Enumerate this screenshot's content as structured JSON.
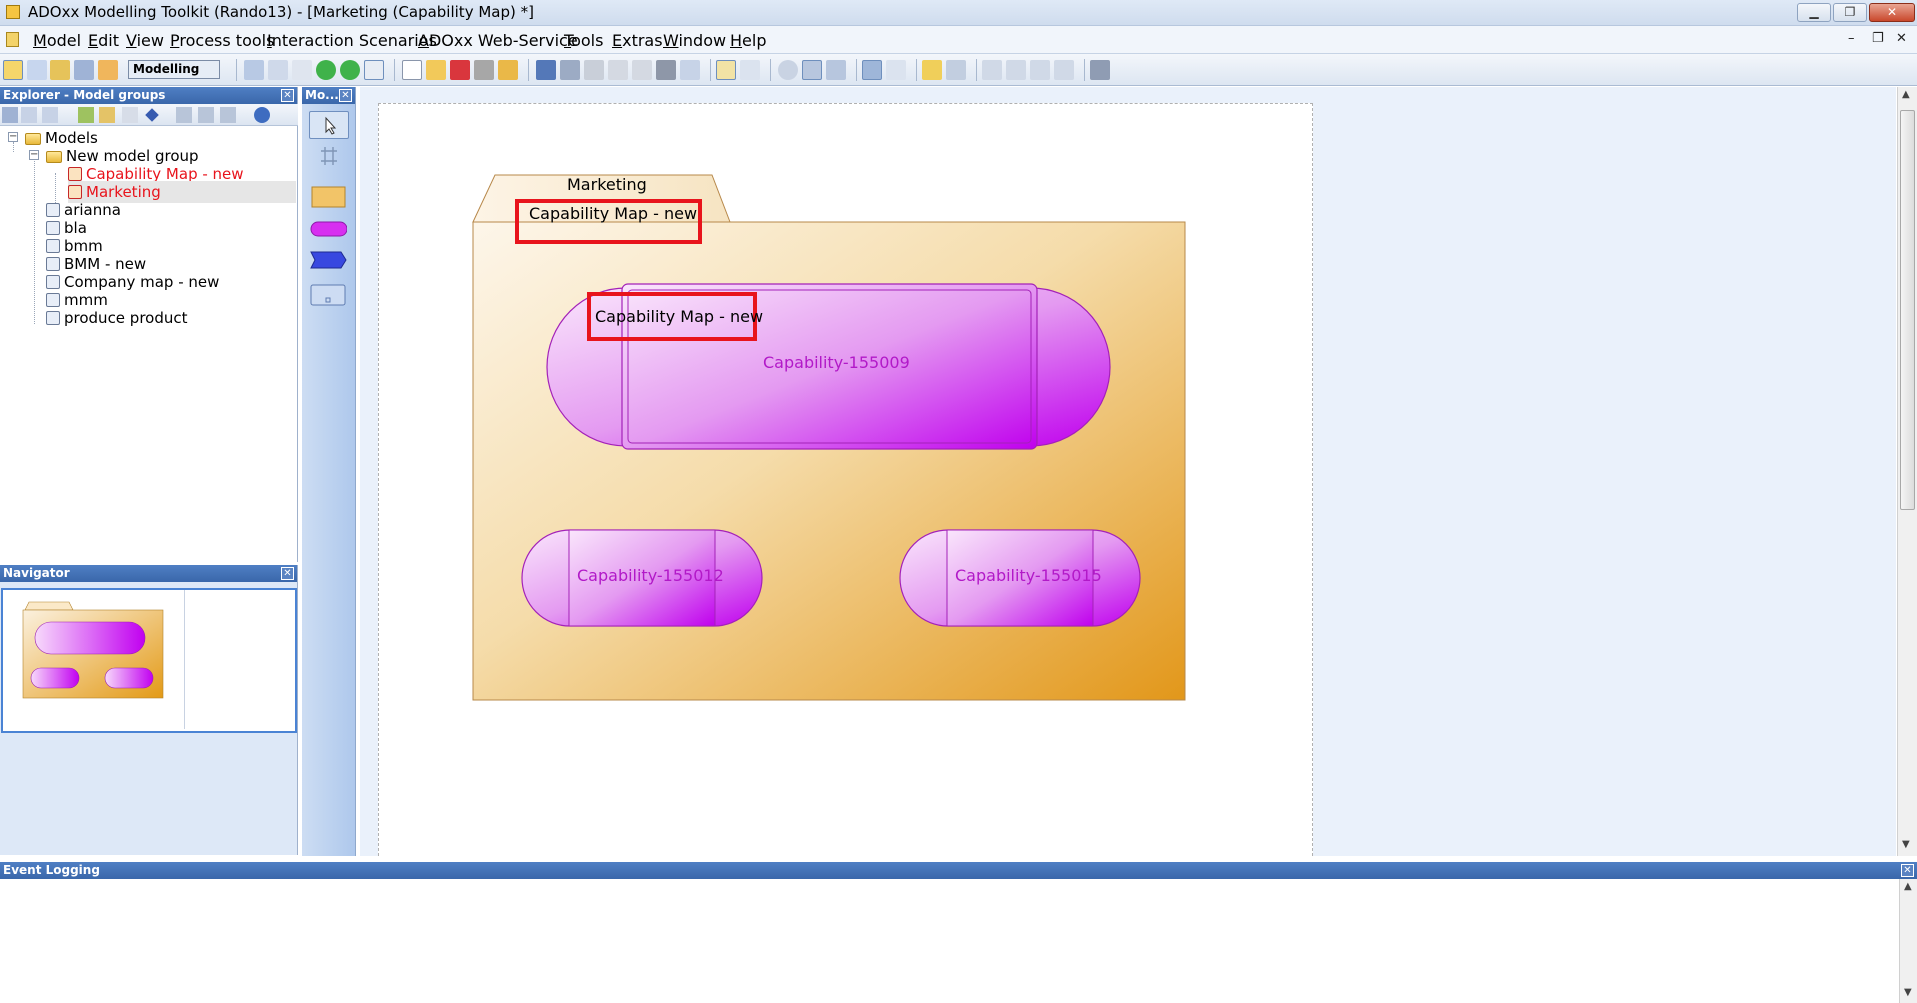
{
  "window": {
    "title": "ADOxx Modelling Toolkit (Rando13) - [Marketing (Capability Map) *]",
    "min_label": "▁",
    "max_label": "❐",
    "close_label": "✕"
  },
  "menu": [
    "Model",
    "Edit",
    "View",
    "Process tools",
    "Interaction Scenarios",
    "ADOxx Web-Service",
    "Tools",
    "Extras",
    "Window",
    "Help"
  ],
  "mdi_controls": [
    "–",
    "❐",
    "✕"
  ],
  "toolbar": {
    "mode": "Modelling"
  },
  "explorer": {
    "title": "Explorer - Model groups",
    "close": "✕",
    "tree": [
      {
        "label": "Models",
        "icon": "folder-icon"
      },
      {
        "label": "New model group",
        "icon": "folder-icon"
      },
      {
        "label": "Capability Map - new",
        "icon": "model-red-icon",
        "color": "#e8141c"
      },
      {
        "label": "Marketing",
        "icon": "model-red-icon",
        "color": "#e8141c"
      },
      {
        "label": "arianna",
        "icon": "model-icon"
      },
      {
        "label": "bla",
        "icon": "model-icon"
      },
      {
        "label": "bmm",
        "icon": "model-icon"
      },
      {
        "label": "BMM - new",
        "icon": "model-icon"
      },
      {
        "label": "Company map - new",
        "icon": "model-icon"
      },
      {
        "label": "mmm",
        "icon": "model-icon"
      },
      {
        "label": "produce product",
        "icon": "model-icon"
      }
    ]
  },
  "palette": {
    "title": "Mo...",
    "close": "✕"
  },
  "navigator": {
    "title": "Navigator",
    "close": "✕"
  },
  "diagram": {
    "folder_tab_label": "Marketing",
    "folder_name": "Capability Map - new",
    "capabilities": [
      {
        "label": "Capability-155009",
        "ref": "Capability Map - new"
      },
      {
        "label": "Capability-155012"
      },
      {
        "label": "Capability-155015"
      }
    ],
    "colors": {
      "folder_light": "#fbf1df",
      "folder_dark": "#e39a16",
      "cap_light": "#f7d9fb",
      "cap_dark": "#c100f0",
      "cap_text": "#b219c8",
      "highlight": "#e8141c"
    }
  },
  "event_log": {
    "title": "Event Logging",
    "close": "✕"
  }
}
